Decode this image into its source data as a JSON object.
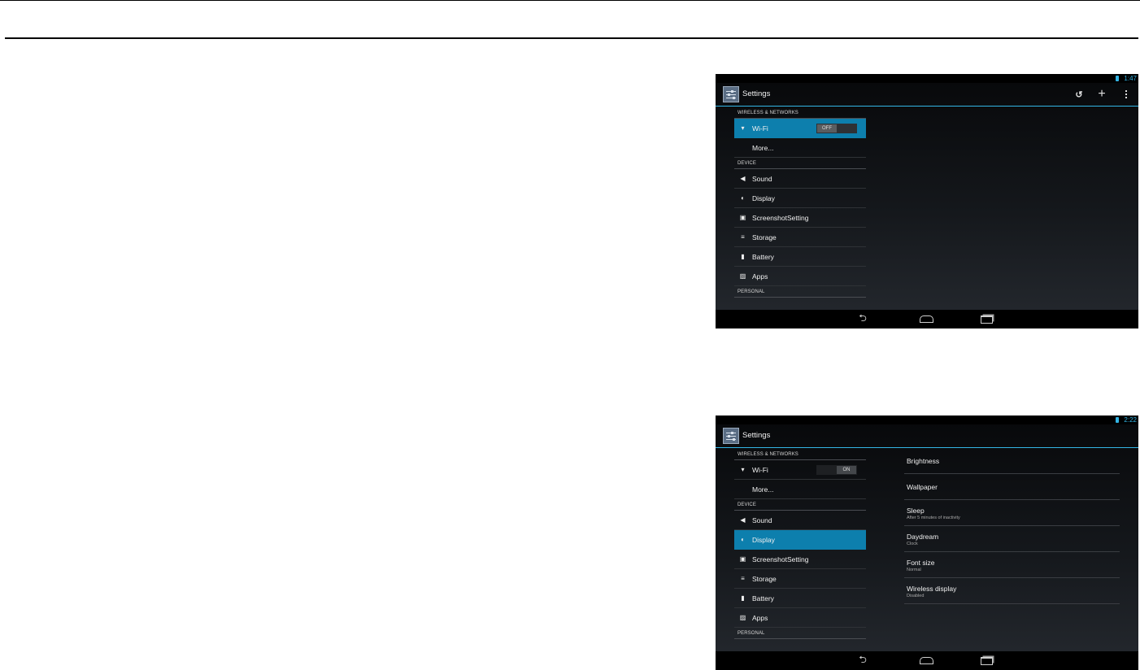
{
  "colors": {
    "accent": "#33b5e5",
    "selected": "#0d7fad",
    "background": "#15181c"
  },
  "screens": [
    {
      "status": {
        "time": "1:47",
        "battery_icon": "battery-icon"
      },
      "actionbar": {
        "title": "Settings",
        "icons": [
          "sync-icon",
          "add-icon",
          "overflow-menu-icon"
        ]
      },
      "list": {
        "wireless_header": "WIRELESS & NETWORKS",
        "wifi_label": "Wi-Fi",
        "wifi_toggle": "OFF",
        "more_label": "More...",
        "device_header": "DEVICE",
        "sound": "Sound",
        "display": "Display",
        "screenshot": "ScreenshotSetting",
        "storage": "Storage",
        "battery": "Battery",
        "apps": "Apps",
        "personal_header": "PERSONAL"
      },
      "selected_item": "Wi-Fi"
    },
    {
      "status": {
        "time": "2:22",
        "battery_icon": "battery-icon"
      },
      "actionbar": {
        "title": "Settings"
      },
      "list": {
        "wireless_header": "WIRELESS & NETWORKS",
        "wifi_label": "Wi-Fi",
        "wifi_toggle": "ON",
        "more_label": "More...",
        "device_header": "DEVICE",
        "sound": "Sound",
        "display": "Display",
        "screenshot": "ScreenshotSetting",
        "storage": "Storage",
        "battery": "Battery",
        "apps": "Apps",
        "personal_header": "PERSONAL"
      },
      "selected_item": "Display",
      "display_prefs": [
        {
          "title": "Brightness"
        },
        {
          "title": "Wallpaper"
        },
        {
          "title": "Sleep",
          "summary": "After 5 minutes of inactivity"
        },
        {
          "title": "Daydream",
          "summary": "Clock"
        },
        {
          "title": "Font size",
          "summary": "Normal"
        },
        {
          "title": "Wireless display",
          "summary": "Disabled"
        }
      ]
    }
  ]
}
